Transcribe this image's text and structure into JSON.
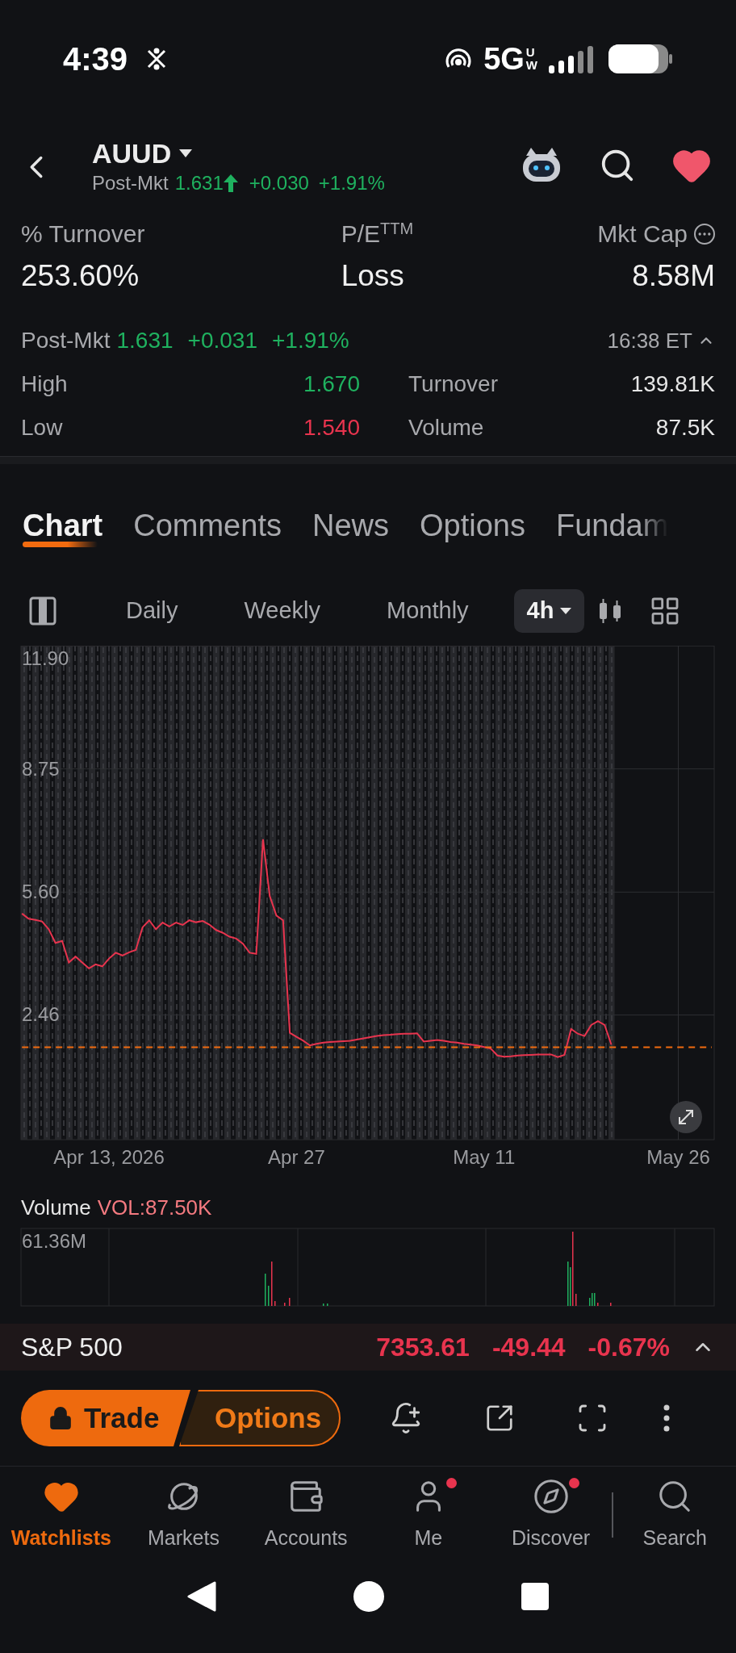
{
  "status_bar": {
    "time": "4:39",
    "network": "5G",
    "network_badge_top": "U",
    "network_badge_bottom": "W"
  },
  "header": {
    "symbol": "AUUD",
    "session": "Post-Mkt",
    "price": "1.631",
    "change": "+0.030",
    "percent": "+1.91%",
    "color": "#1fb15f",
    "favorited": true
  },
  "stats": [
    {
      "label": "% Turnover",
      "value": "253.60%",
      "info": false
    },
    {
      "label": "P/E$^{TTM}$",
      "value": "Loss",
      "info": false
    },
    {
      "label": "Mkt Cap",
      "value": "8.58M",
      "info": true
    }
  ],
  "quote": {
    "session": "Post-Mkt",
    "price": "1.631",
    "change": "+0.031",
    "percent": "+1.91%",
    "color": "#1fb15f",
    "time": "16:38 ET",
    "expanded": true
  },
  "metrics": [
    {
      "label": "High",
      "value": "1.670",
      "color": "#1fb15f"
    },
    {
      "label": "Turnover",
      "value": "139.81K",
      "color": "#e6e6e6"
    },
    {
      "label": "Low",
      "value": "1.540",
      "color": "#e8344e"
    },
    {
      "label": "Volume",
      "value": "87.5K",
      "color": "#e6e6e6"
    }
  ],
  "tabs": [
    {
      "label": "Chart",
      "selected": true
    },
    {
      "label": "Comments",
      "selected": false
    },
    {
      "label": "News",
      "selected": false
    },
    {
      "label": "Options",
      "selected": false
    },
    {
      "label": "Fundam",
      "selected": false
    }
  ],
  "periods": [
    {
      "label": "Daily",
      "selected": false,
      "dropdown": false
    },
    {
      "label": "Weekly",
      "selected": false,
      "dropdown": false
    },
    {
      "label": "Monthly",
      "selected": false,
      "dropdown": false
    },
    {
      "label": "4h",
      "selected": true,
      "dropdown": true
    }
  ],
  "chart": {
    "chart_data": {
      "type": "line",
      "categories": [
        null,
        null,
        null,
        null,
        null,
        null,
        null,
        null,
        null,
        null,
        null,
        null,
        null,
        "Apr 13, 2026",
        null,
        null,
        null,
        null,
        null,
        null,
        null,
        null,
        null,
        null,
        null,
        null,
        null,
        null,
        null,
        null,
        null,
        null,
        null,
        null,
        null,
        null,
        null,
        null,
        null,
        null,
        null,
        "Apr 27",
        null,
        null,
        null,
        null,
        null,
        null,
        null,
        null,
        null,
        null,
        null,
        null,
        null,
        null,
        null,
        null,
        null,
        null,
        null,
        null,
        null,
        null,
        null,
        null,
        null,
        null,
        null,
        "May 11",
        null,
        null,
        null,
        null,
        null,
        null,
        null,
        null,
        null,
        null,
        null,
        null,
        null,
        null,
        null,
        null,
        null,
        null,
        null,
        null,
        null,
        null,
        null,
        null,
        null,
        null,
        null,
        null,
        "May 26",
        null,
        null,
        null,
        null,
        null
      ],
      "series": [
        {
          "color": "#e8344e",
          "line_style": "solid",
          "values": [
            5.05,
            4.92,
            4.89,
            4.85,
            4.65,
            4.3,
            4.35,
            3.8,
            3.95,
            3.8,
            3.65,
            3.75,
            3.7,
            3.9,
            4.05,
            3.98,
            4.06,
            4.12,
            4.7,
            4.88,
            4.65,
            4.82,
            4.72,
            4.82,
            4.76,
            4.88,
            4.83,
            4.86,
            4.77,
            4.63,
            4.56,
            4.46,
            4.41,
            4.28,
            4.05,
            4.02,
            6.95,
            5.5,
            5.0,
            4.88,
            2.0,
            1.9,
            1.8,
            1.68,
            1.72,
            1.75,
            1.77,
            1.78,
            1.79,
            1.8,
            1.83,
            1.86,
            1.89,
            1.92,
            1.94,
            1.95,
            1.97,
            1.98,
            1.98,
            1.99,
            1.78,
            1.8,
            1.82,
            1.8,
            1.77,
            1.75,
            1.72,
            1.7,
            1.68,
            1.64,
            1.6,
            1.42,
            1.39,
            1.4,
            1.42,
            1.43,
            1.44,
            1.45,
            1.45,
            1.45,
            1.38,
            1.44,
            2.1,
            1.98,
            1.92,
            2.2,
            2.3,
            2.2,
            1.7,
            null,
            null,
            null,
            null,
            null,
            null,
            null,
            null,
            null,
            null,
            null,
            null,
            null,
            null,
            null
          ]
        },
        {
          "color": "#f26b0f",
          "line_style": "dashed",
          "values": [
            1.631,
            1.631,
            1.631,
            1.631,
            1.631,
            1.631,
            1.631,
            1.631,
            1.631,
            1.631,
            1.631,
            1.631,
            1.631,
            1.631,
            1.631,
            1.631,
            1.631,
            1.631,
            1.631,
            1.631,
            1.631,
            1.631,
            1.631,
            1.631,
            1.631,
            1.631,
            1.631,
            1.631,
            1.631,
            1.631,
            1.631,
            1.631,
            1.631,
            1.631,
            1.631,
            1.631,
            1.631,
            1.631,
            1.631,
            1.631,
            1.631,
            1.631,
            1.631,
            1.631,
            1.631,
            1.631,
            1.631,
            1.631,
            1.631,
            1.631,
            1.631,
            1.631,
            1.631,
            1.631,
            1.631,
            1.631,
            1.631,
            1.631,
            1.631,
            1.631,
            1.631,
            1.631,
            1.631,
            1.631,
            1.631,
            1.631,
            1.631,
            1.631,
            1.631,
            1.631,
            1.631,
            1.631,
            1.631,
            1.631,
            1.631,
            1.631,
            1.631,
            1.631,
            1.631,
            1.631,
            1.631,
            1.631,
            1.631,
            1.631,
            1.631,
            1.631,
            1.631,
            1.631,
            1.631,
            1.631,
            1.631,
            1.631,
            1.631,
            1.631,
            1.631,
            1.631,
            1.631,
            1.631,
            1.631,
            1.631,
            1.631,
            1.631,
            1.631,
            1.631
          ]
        }
      ],
      "ylim": [
        -0.73,
        11.9
      ],
      "grid": true,
      "yticks": [
        {
          "value": 11.9,
          "label": "11.90"
        },
        {
          "value": 8.75,
          "label": "8.75"
        },
        {
          "value": 5.6,
          "label": "5.60"
        },
        {
          "value": 2.46,
          "label": "2.46"
        }
      ]
    }
  },
  "volume": {
    "label": "Volume",
    "indicator": "VOL:87.50K",
    "max_label": "61.36M"
  },
  "index_bar": {
    "name": "S&P 500",
    "price": "7353.61",
    "change": "-49.44",
    "percent": "-0.67%",
    "color": "#e8344e",
    "expanded": false
  },
  "actions": {
    "trade": "Trade",
    "options": "Options"
  },
  "nav": [
    {
      "label": "Watchlists",
      "kind": "heart",
      "selected": true,
      "badge": false
    },
    {
      "label": "Markets",
      "kind": "planet",
      "selected": false,
      "badge": false
    },
    {
      "label": "Accounts",
      "kind": "wallet",
      "selected": false,
      "badge": false
    },
    {
      "label": "Me",
      "kind": "person",
      "selected": false,
      "badge": true
    },
    {
      "label": "Discover",
      "kind": "compass",
      "selected": false,
      "badge": true
    },
    {
      "label": "Search",
      "kind": "search",
      "selected": false,
      "badge": false
    }
  ]
}
